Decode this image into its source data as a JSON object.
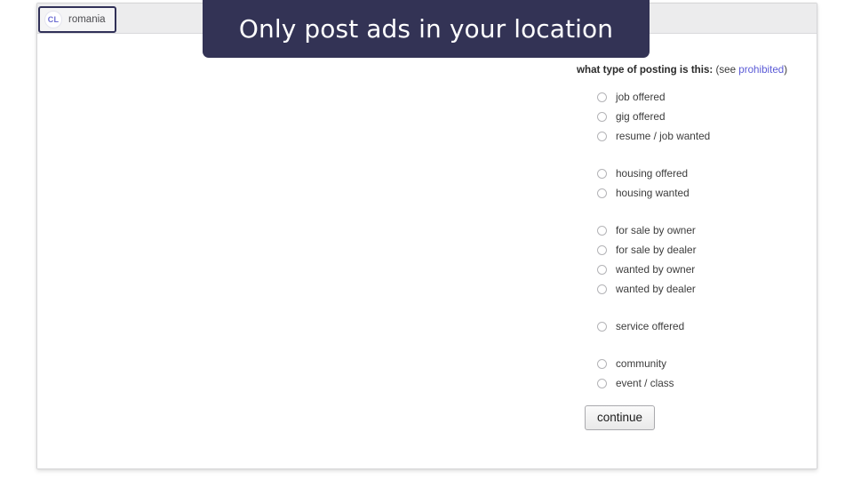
{
  "browser": {
    "tab": {
      "favicon_text": "CL",
      "favicon_icon": "craigslist-logo-icon",
      "title": "romania"
    }
  },
  "banner": {
    "text": "Only post ads in your location",
    "background_color": "#333355",
    "text_color": "#ffffff"
  },
  "form": {
    "heading_strong": "what type of posting is this:",
    "heading_prefix": " (see ",
    "heading_link": "prohibited",
    "heading_suffix": ")",
    "link_color": "#5a5ad6",
    "groups": [
      {
        "options": [
          {
            "label": "job offered",
            "selected": false
          },
          {
            "label": "gig offered",
            "selected": false
          },
          {
            "label": "resume / job wanted",
            "selected": false
          }
        ]
      },
      {
        "options": [
          {
            "label": "housing offered",
            "selected": false
          },
          {
            "label": "housing wanted",
            "selected": false
          }
        ]
      },
      {
        "options": [
          {
            "label": "for sale by owner",
            "selected": false
          },
          {
            "label": "for sale by dealer",
            "selected": false
          },
          {
            "label": "wanted by owner",
            "selected": false
          },
          {
            "label": "wanted by dealer",
            "selected": false
          }
        ]
      },
      {
        "options": [
          {
            "label": "service offered",
            "selected": false
          }
        ]
      },
      {
        "options": [
          {
            "label": "community",
            "selected": false
          },
          {
            "label": "event / class",
            "selected": false
          }
        ]
      }
    ],
    "continue_label": "continue"
  }
}
